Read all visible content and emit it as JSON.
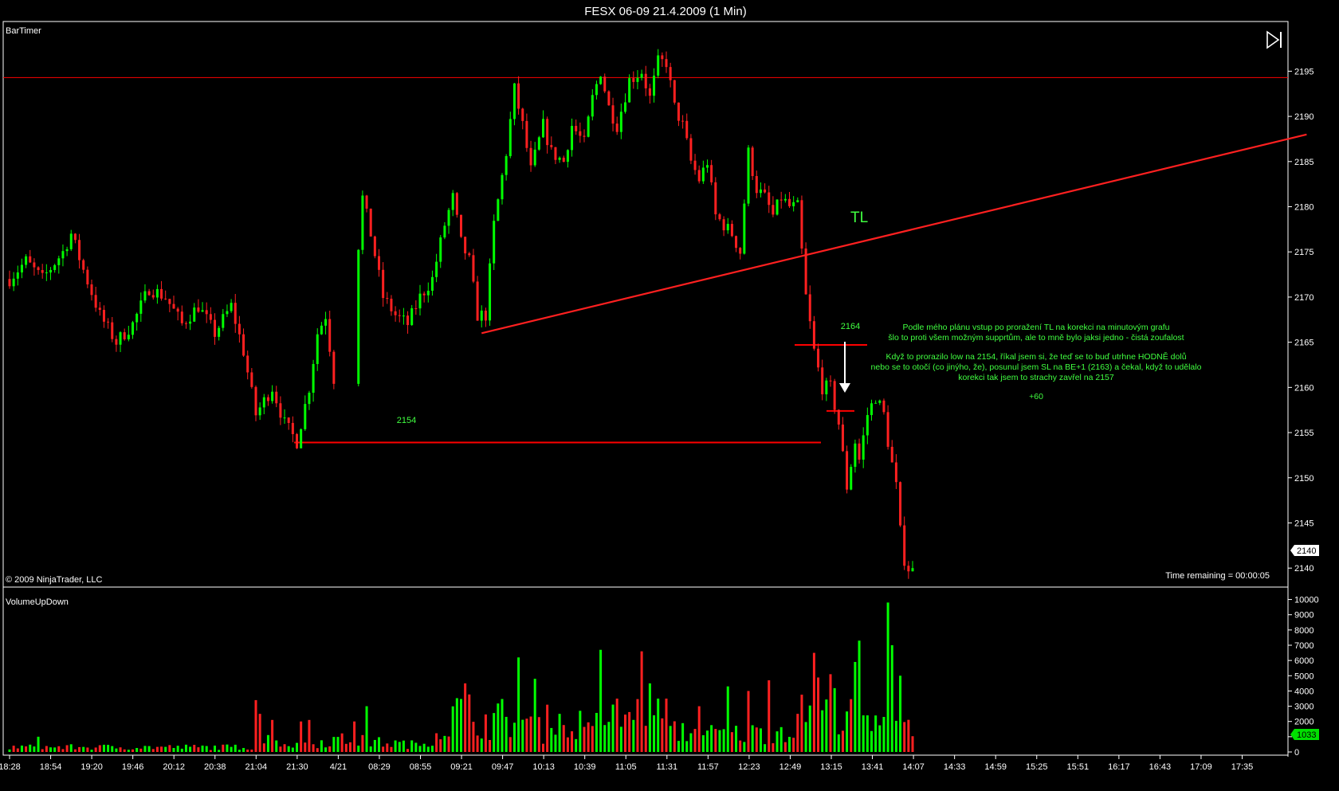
{
  "window_title": "FESX 06-09  21.4.2009 (1 Min)",
  "indicator_top": "BarTimer",
  "indicator_bottom": "VolumeUpDown",
  "copyright": "© 2009 NinjaTrader, LLC",
  "time_remaining": "Time remaining = 00:00:05",
  "last_price_label": "2140",
  "last_volume_label": "1033",
  "colors": {
    "background": "#000000",
    "up": "#00ff00",
    "down": "#ff2020",
    "annotation_line": "#ff2020",
    "annotation_text": "#40ff40",
    "axis_text": "#ffffff",
    "price_line": "#ff0000"
  },
  "annotations": {
    "tl_label": "TL",
    "level_2154": "2154",
    "level_2164": "2164",
    "note_lines": [
      "Podle mého plánu vstup po proražení TL na korekci na minutovým grafu",
      "šlo to proti všem možným supprtům, ale to mně bylo jaksi jedno - čistá zoufalost",
      "",
      "Když to prorazilo low na 2154, říkal jsem si, že teď se to buď utrhne HODNĚ dolů",
      "nebo se to otočí (co jinýho, že), posunul jsem SL na BE+1 (2163) a čekal, když to udělalo",
      "korekci tak jsem to strachy zavřel na 2157",
      "",
      "+60"
    ]
  },
  "chart_data": {
    "type": "candlestick",
    "title": "FESX 06-09  21.4.2009 (1 Min)",
    "x_tick_labels": [
      "18:28",
      "18:54",
      "19:20",
      "19:46",
      "20:12",
      "20:38",
      "21:04",
      "21:30",
      "4/21",
      "08:29",
      "08:55",
      "09:21",
      "09:47",
      "10:13",
      "10:39",
      "11:05",
      "11:31",
      "11:57",
      "12:23",
      "12:49",
      "13:15",
      "13:41",
      "14:07",
      "14:33",
      "14:59",
      "15:25",
      "15:51",
      "16:17",
      "16:43",
      "17:09",
      "17:35"
    ],
    "price_axis": {
      "ticks": [
        2140,
        2145,
        2150,
        2155,
        2160,
        2165,
        2170,
        2175,
        2180,
        2185,
        2190,
        2195
      ],
      "ylim": [
        2137.9,
        2200.5
      ]
    },
    "volume_axis": {
      "ticks": [
        0,
        1000,
        2000,
        3000,
        4000,
        5000,
        6000,
        7000,
        8000,
        9000,
        10000
      ],
      "ylim": [
        0,
        10500
      ]
    },
    "close_path": [
      [
        0,
        2172
      ],
      [
        4,
        2174
      ],
      [
        8,
        2172
      ],
      [
        13,
        2175
      ],
      [
        15,
        2177
      ],
      [
        18,
        2173
      ],
      [
        22,
        2168
      ],
      [
        26,
        2165
      ],
      [
        30,
        2167
      ],
      [
        34,
        2171
      ],
      [
        38,
        2170
      ],
      [
        42,
        2167
      ],
      [
        46,
        2169
      ],
      [
        50,
        2166
      ],
      [
        54,
        2169
      ],
      [
        57,
        2164
      ],
      [
        60,
        2157
      ],
      [
        64,
        2160
      ],
      [
        67,
        2156
      ],
      [
        70,
        2154
      ],
      [
        73,
        2160
      ],
      [
        75,
        2166
      ],
      [
        77,
        2168
      ],
      [
        79,
        2161
      ],
      [
        82,
        2160
      ],
      [
        86,
        2181
      ],
      [
        88,
        2177
      ],
      [
        91,
        2170
      ],
      [
        94,
        2168
      ],
      [
        97,
        2167
      ],
      [
        100,
        2170
      ],
      [
        103,
        2172
      ],
      [
        106,
        2178
      ],
      [
        108,
        2181
      ],
      [
        110,
        2176
      ],
      [
        112,
        2174
      ],
      [
        114,
        2168
      ],
      [
        116,
        2168
      ],
      [
        118,
        2178
      ],
      [
        121,
        2186
      ],
      [
        123,
        2193
      ],
      [
        125,
        2189
      ],
      [
        127,
        2184
      ],
      [
        130,
        2189
      ],
      [
        132,
        2186
      ],
      [
        135,
        2185
      ],
      [
        137,
        2189
      ],
      [
        140,
        2187
      ],
      [
        142,
        2192
      ],
      [
        144,
        2195
      ],
      [
        146,
        2191
      ],
      [
        148,
        2189
      ],
      [
        151,
        2194
      ],
      [
        154,
        2195
      ],
      [
        156,
        2192
      ],
      [
        158,
        2196
      ],
      [
        160,
        2196
      ],
      [
        162,
        2191
      ],
      [
        164,
        2189
      ],
      [
        166,
        2185
      ],
      [
        168,
        2183
      ],
      [
        170,
        2185
      ],
      [
        172,
        2179
      ],
      [
        174,
        2178
      ],
      [
        176,
        2177
      ],
      [
        178,
        2175
      ],
      [
        180,
        2186
      ],
      [
        182,
        2182
      ],
      [
        184,
        2181
      ],
      [
        186,
        2179
      ],
      [
        188,
        2181
      ],
      [
        190,
        2180
      ],
      [
        192,
        2180
      ],
      [
        194,
        2170
      ],
      [
        196,
        2164
      ],
      [
        198,
        2160
      ],
      [
        200,
        2160
      ],
      [
        202,
        2156
      ],
      [
        204,
        2149
      ],
      [
        206,
        2154
      ],
      [
        207,
        2152
      ],
      [
        209,
        2157
      ],
      [
        211,
        2159
      ],
      [
        213,
        2157
      ],
      [
        214,
        2154
      ],
      [
        216,
        2149
      ],
      [
        217,
        2144
      ],
      [
        218,
        2141
      ],
      [
        220,
        2139
      ]
    ],
    "volume_profile": [
      [
        0,
        350
      ],
      [
        60,
        350
      ],
      [
        63,
        900
      ],
      [
        70,
        450
      ],
      [
        75,
        700
      ],
      [
        80,
        900
      ],
      [
        100,
        500
      ],
      [
        105,
        1600
      ],
      [
        108,
        2500
      ],
      [
        110,
        3200
      ],
      [
        113,
        2600
      ],
      [
        115,
        2300
      ],
      [
        117,
        2200
      ],
      [
        120,
        2500
      ],
      [
        130,
        1500
      ],
      [
        140,
        1200
      ],
      [
        145,
        2400
      ],
      [
        150,
        2600
      ],
      [
        155,
        2800
      ],
      [
        160,
        1400
      ],
      [
        165,
        1500
      ],
      [
        170,
        1300
      ],
      [
        175,
        1300
      ],
      [
        180,
        1300
      ],
      [
        185,
        1500
      ],
      [
        190,
        1700
      ],
      [
        193,
        2700
      ],
      [
        195,
        3800
      ],
      [
        197,
        3900
      ],
      [
        200,
        3000
      ],
      [
        204,
        3600
      ],
      [
        206,
        4200
      ],
      [
        208,
        2400
      ],
      [
        212,
        1500
      ],
      [
        214,
        2600
      ],
      [
        216,
        3900
      ],
      [
        217,
        3400
      ],
      [
        218,
        2300
      ],
      [
        220,
        1600
      ]
    ],
    "volume_spikes": [
      [
        7,
        1000
      ],
      [
        60,
        3400
      ],
      [
        61,
        2500
      ],
      [
        64,
        2100
      ],
      [
        71,
        2000
      ],
      [
        73,
        2100
      ],
      [
        84,
        2000
      ],
      [
        87,
        3000
      ],
      [
        111,
        4500
      ],
      [
        124,
        6200
      ],
      [
        128,
        4800
      ],
      [
        131,
        3100
      ],
      [
        134,
        2500
      ],
      [
        139,
        2700
      ],
      [
        144,
        6700
      ],
      [
        148,
        3500
      ],
      [
        154,
        6600
      ],
      [
        156,
        4500
      ],
      [
        158,
        3500
      ],
      [
        160,
        3500
      ],
      [
        168,
        3000
      ],
      [
        175,
        4300
      ],
      [
        180,
        4000
      ],
      [
        185,
        4700
      ],
      [
        196,
        6500
      ],
      [
        200,
        5100
      ],
      [
        207,
        7300
      ],
      [
        214,
        9800
      ],
      [
        215,
        7000
      ],
      [
        217,
        5000
      ]
    ],
    "horizontal_lines": [
      {
        "label": "",
        "price": 2194.3
      },
      {
        "label": "2154",
        "price": 2153.9
      },
      {
        "label": "2164",
        "price": 2164.7
      },
      {
        "label": "",
        "price": 2157.4
      }
    ],
    "trend_line": {
      "label": "TL",
      "from": [
        115,
        2166.0
      ],
      "to": [
        316,
        2188.0
      ]
    },
    "last_price": 2140,
    "last_volume": 1033
  }
}
